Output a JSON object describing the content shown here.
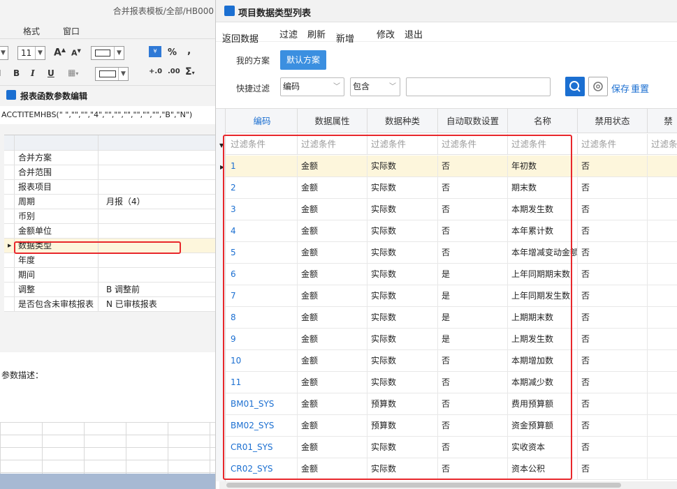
{
  "left": {
    "title": "合并报表模板/全部/HB000",
    "menu": [
      "格式",
      "窗口"
    ],
    "font_size": "11",
    "panel_title": "报表函数参数编辑",
    "formula": "ACCTITEMHBS(\" \",\"\",\"\",\"4\",\"\",\"\",\"\",\"\",\"\",\"\",\"B\",\"N\")",
    "params": [
      {
        "key": "合并方案",
        "value": ""
      },
      {
        "key": "合并范围",
        "value": ""
      },
      {
        "key": "报表项目",
        "value": ""
      },
      {
        "key": "周期",
        "value": "月报（4）"
      },
      {
        "key": "币别",
        "value": ""
      },
      {
        "key": "金额单位",
        "value": ""
      },
      {
        "key": "数据类型",
        "value": ""
      },
      {
        "key": "年度",
        "value": ""
      },
      {
        "key": "期间",
        "value": ""
      },
      {
        "key": "调整",
        "value": "B  调整前"
      },
      {
        "key": "是否包含未审核报表",
        "value": "N  已审核报表"
      }
    ],
    "desc_label": "参数描述："
  },
  "dialog": {
    "title": "项目数据类型列表",
    "menu": {
      "back": "返回数据",
      "filter": "过滤",
      "refresh": "刷新",
      "add": "新增",
      "modify": "修改",
      "exit": "退出"
    },
    "my_plan": "我的方案",
    "default_plan": "默认方案",
    "quick_filter": "快捷过滤",
    "filter_field": "编码",
    "filter_op": "包含",
    "filter_value": "",
    "save": "保存",
    "reset": "重置",
    "columns": [
      "编码",
      "数据属性",
      "数据种类",
      "自动取数设置",
      "名称",
      "禁用状态",
      "禁"
    ],
    "filter_placeholder": "过滤条件",
    "rows": [
      [
        "1",
        "金额",
        "实际数",
        "否",
        "年初数",
        "否"
      ],
      [
        "2",
        "金额",
        "实际数",
        "否",
        "期末数",
        "否"
      ],
      [
        "3",
        "金额",
        "实际数",
        "否",
        "本期发生数",
        "否"
      ],
      [
        "4",
        "金额",
        "实际数",
        "否",
        "本年累计数",
        "否"
      ],
      [
        "5",
        "金额",
        "实际数",
        "否",
        "本年增减变动金额",
        "否"
      ],
      [
        "6",
        "金额",
        "实际数",
        "是",
        "上年同期期末数",
        "否"
      ],
      [
        "7",
        "金额",
        "实际数",
        "是",
        "上年同期发生数",
        "否"
      ],
      [
        "8",
        "金额",
        "实际数",
        "是",
        "上期期末数",
        "否"
      ],
      [
        "9",
        "金额",
        "实际数",
        "是",
        "上期发生数",
        "否"
      ],
      [
        "10",
        "金额",
        "实际数",
        "否",
        "本期增加数",
        "否"
      ],
      [
        "11",
        "金额",
        "实际数",
        "否",
        "本期减少数",
        "否"
      ],
      [
        "BM01_SYS",
        "金额",
        "预算数",
        "否",
        "费用预算额",
        "否"
      ],
      [
        "BM02_SYS",
        "金额",
        "预算数",
        "否",
        "资金预算额",
        "否"
      ],
      [
        "CR01_SYS",
        "金额",
        "实际数",
        "否",
        "实收资本",
        "否"
      ],
      [
        "CR02_SYS",
        "金额",
        "实际数",
        "否",
        "资本公积",
        "否"
      ]
    ]
  }
}
